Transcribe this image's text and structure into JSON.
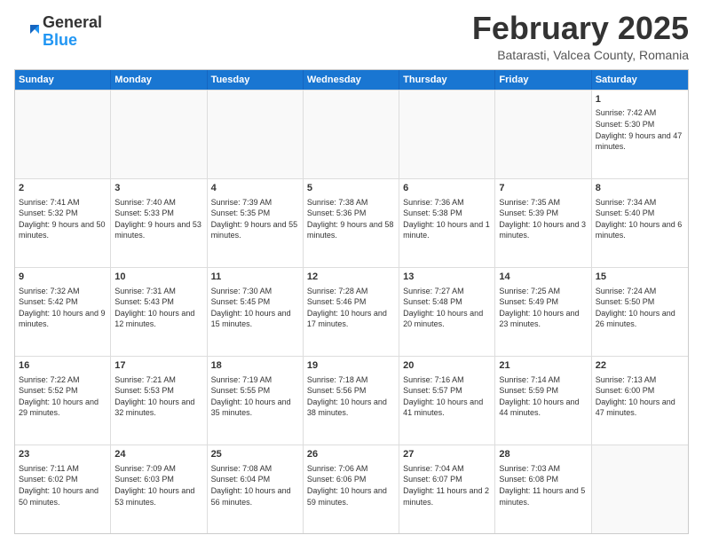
{
  "header": {
    "logo": {
      "general": "General",
      "blue": "Blue"
    },
    "title": "February 2025",
    "location": "Batarasti, Valcea County, Romania"
  },
  "weekdays": [
    "Sunday",
    "Monday",
    "Tuesday",
    "Wednesday",
    "Thursday",
    "Friday",
    "Saturday"
  ],
  "rows": [
    [
      {
        "day": "",
        "info": ""
      },
      {
        "day": "",
        "info": ""
      },
      {
        "day": "",
        "info": ""
      },
      {
        "day": "",
        "info": ""
      },
      {
        "day": "",
        "info": ""
      },
      {
        "day": "",
        "info": ""
      },
      {
        "day": "1",
        "info": "Sunrise: 7:42 AM\nSunset: 5:30 PM\nDaylight: 9 hours and 47 minutes."
      }
    ],
    [
      {
        "day": "2",
        "info": "Sunrise: 7:41 AM\nSunset: 5:32 PM\nDaylight: 9 hours and 50 minutes."
      },
      {
        "day": "3",
        "info": "Sunrise: 7:40 AM\nSunset: 5:33 PM\nDaylight: 9 hours and 53 minutes."
      },
      {
        "day": "4",
        "info": "Sunrise: 7:39 AM\nSunset: 5:35 PM\nDaylight: 9 hours and 55 minutes."
      },
      {
        "day": "5",
        "info": "Sunrise: 7:38 AM\nSunset: 5:36 PM\nDaylight: 9 hours and 58 minutes."
      },
      {
        "day": "6",
        "info": "Sunrise: 7:36 AM\nSunset: 5:38 PM\nDaylight: 10 hours and 1 minute."
      },
      {
        "day": "7",
        "info": "Sunrise: 7:35 AM\nSunset: 5:39 PM\nDaylight: 10 hours and 3 minutes."
      },
      {
        "day": "8",
        "info": "Sunrise: 7:34 AM\nSunset: 5:40 PM\nDaylight: 10 hours and 6 minutes."
      }
    ],
    [
      {
        "day": "9",
        "info": "Sunrise: 7:32 AM\nSunset: 5:42 PM\nDaylight: 10 hours and 9 minutes."
      },
      {
        "day": "10",
        "info": "Sunrise: 7:31 AM\nSunset: 5:43 PM\nDaylight: 10 hours and 12 minutes."
      },
      {
        "day": "11",
        "info": "Sunrise: 7:30 AM\nSunset: 5:45 PM\nDaylight: 10 hours and 15 minutes."
      },
      {
        "day": "12",
        "info": "Sunrise: 7:28 AM\nSunset: 5:46 PM\nDaylight: 10 hours and 17 minutes."
      },
      {
        "day": "13",
        "info": "Sunrise: 7:27 AM\nSunset: 5:48 PM\nDaylight: 10 hours and 20 minutes."
      },
      {
        "day": "14",
        "info": "Sunrise: 7:25 AM\nSunset: 5:49 PM\nDaylight: 10 hours and 23 minutes."
      },
      {
        "day": "15",
        "info": "Sunrise: 7:24 AM\nSunset: 5:50 PM\nDaylight: 10 hours and 26 minutes."
      }
    ],
    [
      {
        "day": "16",
        "info": "Sunrise: 7:22 AM\nSunset: 5:52 PM\nDaylight: 10 hours and 29 minutes."
      },
      {
        "day": "17",
        "info": "Sunrise: 7:21 AM\nSunset: 5:53 PM\nDaylight: 10 hours and 32 minutes."
      },
      {
        "day": "18",
        "info": "Sunrise: 7:19 AM\nSunset: 5:55 PM\nDaylight: 10 hours and 35 minutes."
      },
      {
        "day": "19",
        "info": "Sunrise: 7:18 AM\nSunset: 5:56 PM\nDaylight: 10 hours and 38 minutes."
      },
      {
        "day": "20",
        "info": "Sunrise: 7:16 AM\nSunset: 5:57 PM\nDaylight: 10 hours and 41 minutes."
      },
      {
        "day": "21",
        "info": "Sunrise: 7:14 AM\nSunset: 5:59 PM\nDaylight: 10 hours and 44 minutes."
      },
      {
        "day": "22",
        "info": "Sunrise: 7:13 AM\nSunset: 6:00 PM\nDaylight: 10 hours and 47 minutes."
      }
    ],
    [
      {
        "day": "23",
        "info": "Sunrise: 7:11 AM\nSunset: 6:02 PM\nDaylight: 10 hours and 50 minutes."
      },
      {
        "day": "24",
        "info": "Sunrise: 7:09 AM\nSunset: 6:03 PM\nDaylight: 10 hours and 53 minutes."
      },
      {
        "day": "25",
        "info": "Sunrise: 7:08 AM\nSunset: 6:04 PM\nDaylight: 10 hours and 56 minutes."
      },
      {
        "day": "26",
        "info": "Sunrise: 7:06 AM\nSunset: 6:06 PM\nDaylight: 10 hours and 59 minutes."
      },
      {
        "day": "27",
        "info": "Sunrise: 7:04 AM\nSunset: 6:07 PM\nDaylight: 11 hours and 2 minutes."
      },
      {
        "day": "28",
        "info": "Sunrise: 7:03 AM\nSunset: 6:08 PM\nDaylight: 11 hours and 5 minutes."
      },
      {
        "day": "",
        "info": ""
      }
    ]
  ]
}
